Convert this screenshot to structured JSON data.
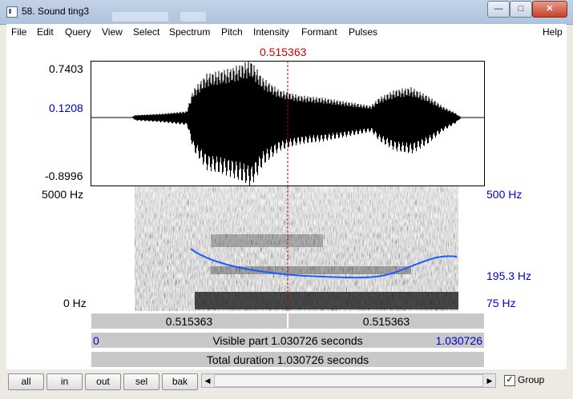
{
  "window": {
    "title": "58. Sound ting3",
    "controls": {
      "minimize": "—",
      "maximize": "□",
      "close": "✕"
    }
  },
  "menu": [
    "File",
    "Edit",
    "Query",
    "View",
    "Select",
    "Spectrum",
    "Pitch",
    "Intensity",
    "Formant",
    "Pulses",
    "Help"
  ],
  "cursor": {
    "time_label": "0.515363",
    "time_fraction": 0.5,
    "color": "#cc0000"
  },
  "waveform": {
    "y_max": "0.7403",
    "y_cursor": "0.1208",
    "y_min": "-0.8996",
    "envelope_max": 0.7403,
    "envelope_min": -0.8996
  },
  "spectrogram": {
    "freq_top": "5000 Hz",
    "freq_bottom": "0 Hz",
    "pitch_top": "500 Hz",
    "pitch_value": "195.3 Hz",
    "pitch_bottom": "75 Hz",
    "pitch_color": "#1a5cff"
  },
  "bars": {
    "left_segment": "0.515363",
    "right_segment": "0.515363",
    "visible_start": "0",
    "visible_label": "Visible part 1.030726 seconds",
    "visible_end": "1.030726",
    "total_label": "Total duration 1.030726 seconds"
  },
  "toolbar": {
    "buttons": [
      "all",
      "in",
      "out",
      "sel",
      "bak"
    ],
    "group_label": "Group",
    "group_checked": true,
    "check_mark": "✓",
    "scroll_left": "◀",
    "scroll_right": "▶"
  }
}
